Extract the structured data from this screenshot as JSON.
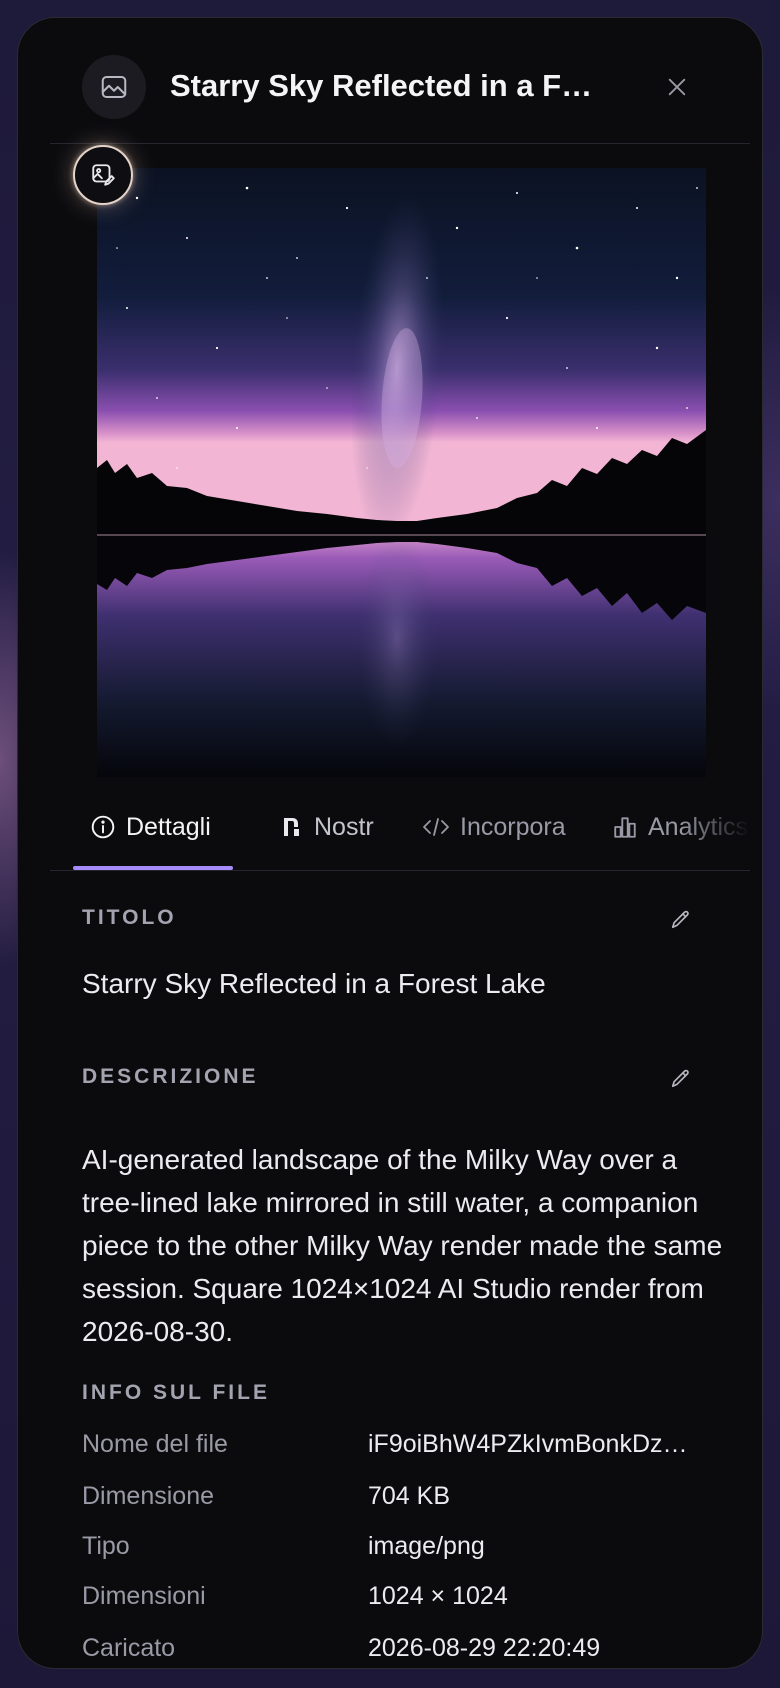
{
  "header": {
    "title": "Starry Sky Reflected in a F…",
    "icon": "image-icon",
    "close_icon": "close-icon"
  },
  "image": {
    "alt": "Starry Sky Reflected in a Forest Lake",
    "edit_icon": "image-edit-icon"
  },
  "tabs": [
    {
      "label": "Dettagli",
      "icon": "info-icon",
      "active": true
    },
    {
      "label": "Nostr",
      "icon": "nostr-icon",
      "active": false
    },
    {
      "label": "Incorpora",
      "icon": "code-icon",
      "active": false
    },
    {
      "label": "Analytics",
      "icon": "bar-chart-icon",
      "active": false
    }
  ],
  "details": {
    "title_label": "TITOLO",
    "title_value": "Starry Sky Reflected in a Forest Lake",
    "description_label": "DESCRIZIONE",
    "description_value": "AI-generated landscape of the Milky Way over a tree-lined lake mirrored in still water, a companion piece to the other Milky Way render made the same session. Square 1024×1024 AI Studio render from 2026-08-30.",
    "file_info_label": "INFO SUL FILE",
    "file_info": [
      {
        "key": "Nome del file",
        "value": "iF9oiBhW4PZkIvmBonkDz…"
      },
      {
        "key": "Dimensione",
        "value": "704 KB"
      },
      {
        "key": "Tipo",
        "value": "image/png"
      },
      {
        "key": "Dimensioni",
        "value": "1024 × 1024"
      },
      {
        "key": "Caricato",
        "value": "2026-08-29 22:20:49"
      }
    ]
  },
  "colors": {
    "accent": "#a78bfa",
    "panel_bg": "#0b0b0e",
    "page_bg": "#211c40"
  }
}
